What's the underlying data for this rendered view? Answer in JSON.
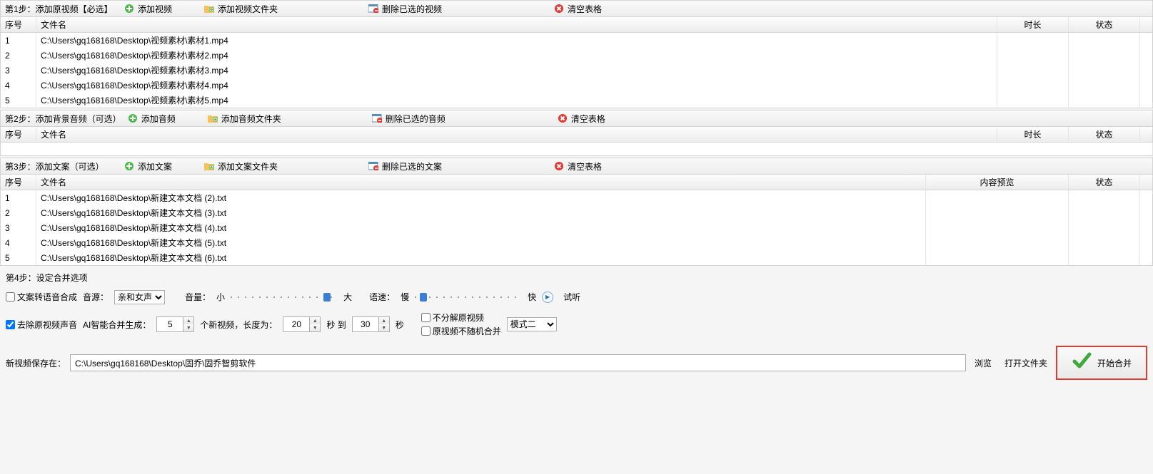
{
  "step1": {
    "label": "第1步：添加原视频【必选】",
    "btn_add": "添加视频",
    "btn_add_folder": "添加视频文件夹",
    "btn_delete": "删除已选的视频",
    "btn_clear": "清空表格",
    "headers": {
      "seq": "序号",
      "file": "文件名",
      "dur": "时长",
      "status": "状态"
    },
    "rows": [
      {
        "seq": "1",
        "file": "C:\\Users\\gq168168\\Desktop\\视频素材\\素材1.mp4"
      },
      {
        "seq": "2",
        "file": "C:\\Users\\gq168168\\Desktop\\视频素材\\素材2.mp4"
      },
      {
        "seq": "3",
        "file": "C:\\Users\\gq168168\\Desktop\\视频素材\\素材3.mp4"
      },
      {
        "seq": "4",
        "file": "C:\\Users\\gq168168\\Desktop\\视频素材\\素材4.mp4"
      },
      {
        "seq": "5",
        "file": "C:\\Users\\gq168168\\Desktop\\视频素材\\素材5.mp4"
      }
    ]
  },
  "step2": {
    "label": "第2步：添加背景音频（可选）",
    "btn_add": "添加音频",
    "btn_add_folder": "添加音频文件夹",
    "btn_delete": "删除已选的音频",
    "btn_clear": "清空表格",
    "headers": {
      "seq": "序号",
      "file": "文件名",
      "dur": "时长",
      "status": "状态"
    }
  },
  "step3": {
    "label": "第3步：添加文案（可选）",
    "btn_add": "添加文案",
    "btn_add_folder": "添加文案文件夹",
    "btn_delete": "删除已选的文案",
    "btn_clear": "清空表格",
    "headers": {
      "seq": "序号",
      "file": "文件名",
      "preview": "内容预览",
      "status": "状态"
    },
    "rows": [
      {
        "seq": "1",
        "file": "C:\\Users\\gq168168\\Desktop\\新建文本文档 (2).txt"
      },
      {
        "seq": "2",
        "file": "C:\\Users\\gq168168\\Desktop\\新建文本文档 (3).txt"
      },
      {
        "seq": "3",
        "file": "C:\\Users\\gq168168\\Desktop\\新建文本文档 (4).txt"
      },
      {
        "seq": "4",
        "file": "C:\\Users\\gq168168\\Desktop\\新建文本文档 (5).txt"
      },
      {
        "seq": "5",
        "file": "C:\\Users\\gq168168\\Desktop\\新建文本文档 (6).txt"
      }
    ]
  },
  "step4": {
    "label": "第4步：设定合并选项",
    "chk_tts": "文案转语音合成",
    "voice_label": "音源：",
    "voice_value": "亲和女声",
    "volume_label": "音量：",
    "vol_low": "小",
    "vol_high": "大",
    "speed_label": "语速：",
    "speed_low": "慢",
    "speed_high": "快",
    "btn_preview": "试听",
    "chk_remove_audio": "去除原视频声音",
    "ai_gen_label": "AI智能合并生成：",
    "count_value": "5",
    "count_suffix": "个新视频，长度为：",
    "len_from": "20",
    "len_mid": "秒 到",
    "len_to": "30",
    "len_suffix": "秒",
    "chk_no_split": "不分解原视频",
    "chk_no_random": "原视频不随机合并",
    "mode_value": "模式二"
  },
  "bottom": {
    "save_label": "新视频保存在：",
    "save_path": "C:\\Users\\gq168168\\Desktop\\固乔\\固乔智剪软件",
    "browse": "浏览",
    "open_folder": "打开文件夹",
    "start": "开始合并"
  }
}
